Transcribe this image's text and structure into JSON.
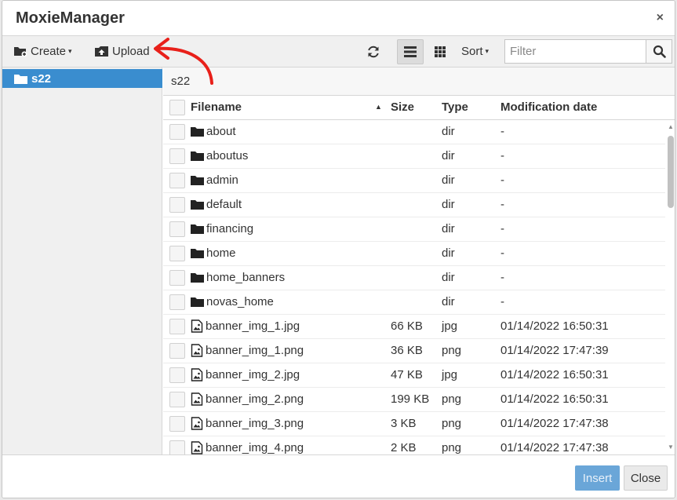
{
  "window": {
    "title": "MoxieManager",
    "close_glyph": "×"
  },
  "toolbar": {
    "create_label": "Create",
    "upload_label": "Upload",
    "sort_label": "Sort",
    "filter_placeholder": "Filter",
    "caret": "▾"
  },
  "sidebar": {
    "items": [
      {
        "label": "s22",
        "selected": true
      }
    ]
  },
  "path": "s22",
  "columns": {
    "filename": "Filename",
    "sort_indicator": "▲",
    "size": "Size",
    "type": "Type",
    "modified": "Modification date"
  },
  "files": [
    {
      "name": "about",
      "size": "",
      "type": "dir",
      "modified": "-",
      "icon": "folder-icon"
    },
    {
      "name": "aboutus",
      "size": "",
      "type": "dir",
      "modified": "-",
      "icon": "folder-icon"
    },
    {
      "name": "admin",
      "size": "",
      "type": "dir",
      "modified": "-",
      "icon": "folder-icon"
    },
    {
      "name": "default",
      "size": "",
      "type": "dir",
      "modified": "-",
      "icon": "folder-icon"
    },
    {
      "name": "financing",
      "size": "",
      "type": "dir",
      "modified": "-",
      "icon": "folder-icon"
    },
    {
      "name": "home",
      "size": "",
      "type": "dir",
      "modified": "-",
      "icon": "folder-icon"
    },
    {
      "name": "home_banners",
      "size": "",
      "type": "dir",
      "modified": "-",
      "icon": "folder-icon"
    },
    {
      "name": "novas_home",
      "size": "",
      "type": "dir",
      "modified": "-",
      "icon": "folder-icon"
    },
    {
      "name": "banner_img_1.jpg",
      "size": "66 KB",
      "type": "jpg",
      "modified": "01/14/2022 16:50:31",
      "icon": "image-file-icon"
    },
    {
      "name": "banner_img_1.png",
      "size": "36 KB",
      "type": "png",
      "modified": "01/14/2022 17:47:39",
      "icon": "image-file-icon"
    },
    {
      "name": "banner_img_2.jpg",
      "size": "47 KB",
      "type": "jpg",
      "modified": "01/14/2022 16:50:31",
      "icon": "image-file-icon"
    },
    {
      "name": "banner_img_2.png",
      "size": "199 KB",
      "type": "png",
      "modified": "01/14/2022 16:50:31",
      "icon": "image-file-icon"
    },
    {
      "name": "banner_img_3.png",
      "size": "3 KB",
      "type": "png",
      "modified": "01/14/2022 17:47:38",
      "icon": "image-file-icon"
    },
    {
      "name": "banner_img_4.png",
      "size": "2 KB",
      "type": "png",
      "modified": "01/14/2022 17:47:38",
      "icon": "image-file-icon"
    }
  ],
  "footer": {
    "insert_label": "Insert",
    "close_label": "Close"
  },
  "colors": {
    "accent": "#3a8dcf",
    "insert_button": "#6aa6d8",
    "annotation_arrow": "#e8201a"
  }
}
